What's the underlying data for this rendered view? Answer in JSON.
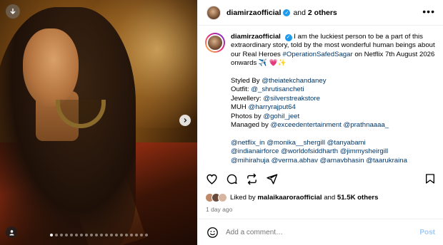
{
  "photo": {
    "download_icon": "arrow-down-circle-icon",
    "next_icon": "chevron-right-icon",
    "tag_icon": "user-icon",
    "carousel_count": 20,
    "carousel_active_index": 0
  },
  "header": {
    "username": "diamirzaofficial",
    "and_text": "and",
    "others": "2 others",
    "more_icon": "more-horizontal-icon"
  },
  "caption": {
    "username": "diamirzaofficial",
    "text1": "I am the luckiest person to be a part of this extraordinary story, told by the most wonderful human beings about our Real Heroes",
    "hashtag1": "#OperationSafedSagar",
    "text2": "on Netflix 7th August 2026 onwards ✈️ 💗✨",
    "styled_label": "Styled By",
    "styled_link": "@theiatekchandaney",
    "outfit_label": "Outfit:",
    "outfit_link": "@_shrutisancheti",
    "jewellery_label": "Jewellery:",
    "jewellery_link": "@silverstreakstore",
    "muh_label": "MUH",
    "muh_link": "@harryrajput64",
    "photos_label": "Photos by",
    "photos_link": "@gohil_jeet",
    "managed_label": "Managed by",
    "managed_link1": "@exceedentertainment",
    "managed_link2": "@prathnaaaa_",
    "tag_line1": "@netflix_in @monika__shergill @tanyabami",
    "tag_line2": "@indianairforce @worldofsiddharth @jimmysheirgill",
    "tag_line3": "@mihirahuja @verma.abhav @arnavbhasin @taarukraina"
  },
  "actions": {
    "like_icon": "heart-icon",
    "comment_icon": "comment-icon",
    "repost_icon": "repost-icon",
    "share_icon": "send-icon",
    "save_icon": "bookmark-icon"
  },
  "likes": {
    "liked_by": "Liked by",
    "user": "malaikaaroraofficial",
    "and": "and",
    "count": "51.5K others"
  },
  "time": "1 day ago",
  "comment": {
    "emoji_icon": "smiley-icon",
    "placeholder": "Add a comment…",
    "post_label": "Post"
  }
}
